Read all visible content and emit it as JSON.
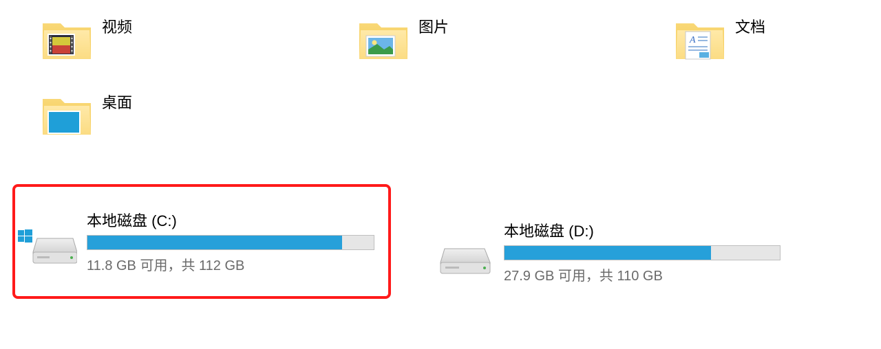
{
  "folders": [
    {
      "name": "视频",
      "icon": "video"
    },
    {
      "name": "图片",
      "icon": "pictures"
    },
    {
      "name": "文档",
      "icon": "documents"
    },
    {
      "name": "桌面",
      "icon": "desktop"
    }
  ],
  "drives": [
    {
      "name": "本地磁盘 (C:)",
      "stats": "11.8 GB 可用，共 112 GB",
      "fill_percent": 89,
      "system": true,
      "highlighted": true
    },
    {
      "name": "本地磁盘 (D:)",
      "stats": "27.9 GB 可用，共 110 GB",
      "fill_percent": 75,
      "system": false,
      "highlighted": false
    }
  ]
}
